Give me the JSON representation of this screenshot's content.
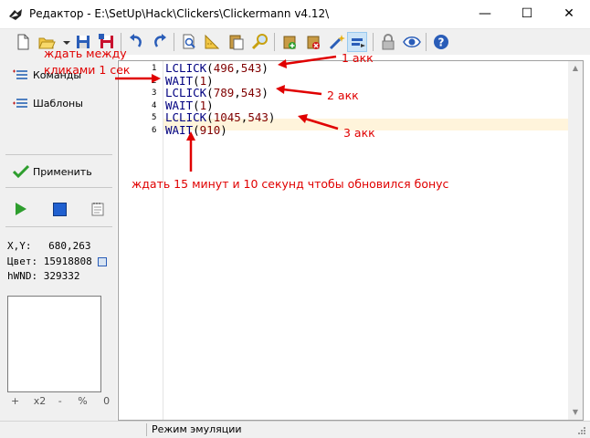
{
  "window": {
    "title": "Редактор - E:\\SetUp\\Hack\\Clickers\\Clickermann v4.12\\",
    "controls": {
      "minimize": "—",
      "maximize": "☐",
      "close": "✕"
    }
  },
  "toolbar": {
    "buttons": [
      "new-file-icon",
      "open-folder-icon",
      "dropdown-arrow-icon",
      "save-icon",
      "save-all-icon",
      "undo-icon",
      "redo-icon",
      "find-icon",
      "ruler-icon",
      "paste-icon",
      "search-icon",
      "add-icon",
      "delete-icon",
      "wand-icon",
      "record-icon",
      "lock-icon",
      "eye-icon",
      "help-icon"
    ]
  },
  "sidebar": {
    "commands_label": "Команды",
    "templates_label": "Шаблоны",
    "apply_label": "Применить",
    "xy_label": "X,Y:",
    "xy_value": "680,263",
    "color_label": "Цвет:",
    "color_value": "15918808",
    "hwnd_label": "hWND:",
    "hwnd_value": "329332",
    "zoom_plus": "+",
    "zoom_x2": "x2",
    "zoom_minus": "-",
    "zoom_percent": "%",
    "zoom_zero": "0"
  },
  "editor": {
    "lines": [
      {
        "num": "1",
        "cmd": "LCLICK",
        "open": "(",
        "args": "496",
        "sep": ",",
        "args2": "543",
        "close": ")"
      },
      {
        "num": "2",
        "cmd": "WAIT",
        "open": "(",
        "args": "1",
        "sep": "",
        "args2": "",
        "close": ")"
      },
      {
        "num": "3",
        "cmd": "LCLICK",
        "open": "(",
        "args": "789",
        "sep": ",",
        "args2": "543",
        "close": ")"
      },
      {
        "num": "4",
        "cmd": "WAIT",
        "open": "(",
        "args": "1",
        "sep": "",
        "args2": "",
        "close": ")"
      },
      {
        "num": "5",
        "cmd": "LCLICK",
        "open": "(",
        "args": "1045",
        "sep": ",",
        "args2": "543",
        "close": ")"
      },
      {
        "num": "6",
        "cmd": "WAIT",
        "open": "(",
        "args": "910",
        "sep": "",
        "args2": "",
        "close": ")"
      }
    ]
  },
  "annotations": {
    "wait_between_1": "ждать между",
    "wait_between_2": "кликами 1 сек",
    "acc1": "1 акк",
    "acc2": "2 акк",
    "acc3": "3 акк",
    "wait_bonus": "ждать 15 минут и 10 секунд чтобы обновился бонус"
  },
  "status": {
    "mode": "Режим эмуляции"
  },
  "colors": {
    "annotation": "#e00000",
    "current_line": "#fff4db",
    "keyword": "#000080",
    "number": "#800000"
  }
}
